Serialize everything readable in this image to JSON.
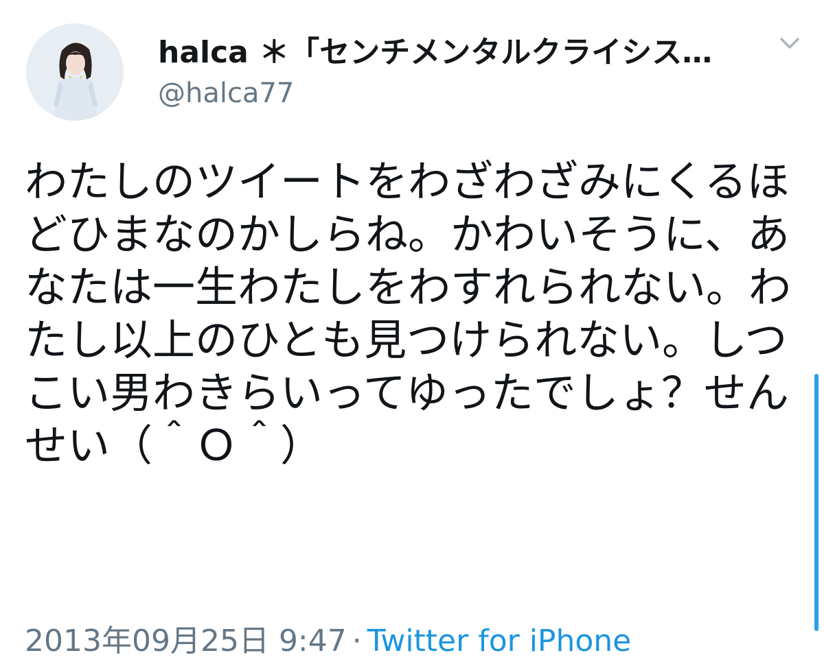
{
  "tweet": {
    "display_name": "halca ＊「センチメンタルクライシス…",
    "handle": "@halca77",
    "body": "わたしのツイートをわざわざみにくるほどひまなのかしらね。かわいそうに、あなたは一生わたしをわすれられない。わたし以上のひとも見つけられない。しつこい男わきらいってゆったでしょ？せんせい（＾Ｏ＾）",
    "timestamp": "2013年09月25日 9:47",
    "separator": "·",
    "source": "Twitter for iPhone"
  },
  "icons": {
    "menu": "chevron-down-icon",
    "avatar": "profile-photo"
  },
  "colors": {
    "source_link": "#1b95e0",
    "secondary_text": "#657786",
    "scroll_indicator": "#2aa0ea"
  }
}
